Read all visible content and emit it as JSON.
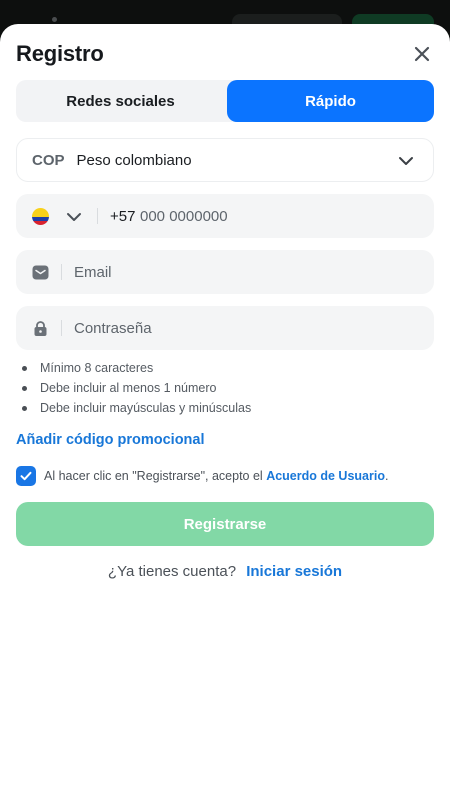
{
  "header": {
    "title": "Registro",
    "close_icon": "close-icon"
  },
  "tabs": [
    {
      "label": "Redes sociales",
      "active": false
    },
    {
      "label": "Rápido",
      "active": true
    }
  ],
  "currency": {
    "code": "COP",
    "name": "Peso colombiano",
    "icon": "chevron-down-icon"
  },
  "phone": {
    "flag_icon": "colombia-flag-icon",
    "prefix": "+57",
    "placeholder": "000 0000000"
  },
  "email": {
    "icon": "mail-icon",
    "placeholder": "Email"
  },
  "password": {
    "icon": "lock-icon",
    "placeholder": "Contraseña"
  },
  "password_rules": [
    "Mínimo 8 caracteres",
    "Debe incluir al menos 1 número",
    "Debe incluir mayúsculas y minúsculas"
  ],
  "promo_link": "Añadir código promocional",
  "agreement": {
    "checked": true,
    "text": "Al hacer clic en \"Registrarse\", acepto el",
    "link": "Acuerdo de Usuario",
    "suffix": "."
  },
  "submit_label": "Registrarse",
  "login": {
    "question": "¿Ya tienes cuenta?",
    "link": "Iniciar sesión"
  },
  "colors": {
    "accent": "#0b74ff",
    "link": "#1877d8",
    "submit_disabled": "#82d8a6"
  }
}
